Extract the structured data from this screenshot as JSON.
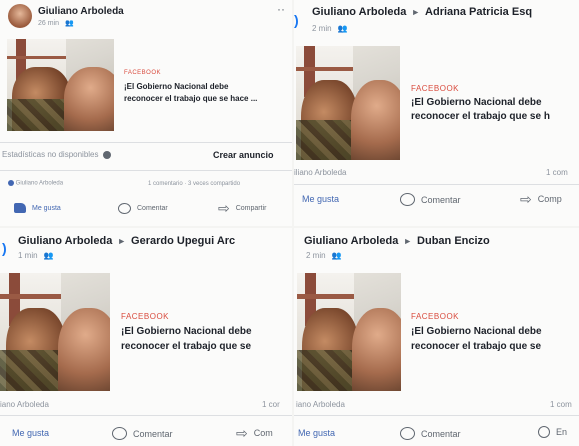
{
  "posts": [
    {
      "author": "Giuliano Arboleda",
      "target": "",
      "time": "26 min",
      "privacy_icon": "friends-icon",
      "source": "FACEBOOK",
      "headline_1": "¡El Gobierno Nacional debe",
      "headline_2": "reconocer el trabajo que se hace ...",
      "stats": "Estadísticas no disponibles",
      "cta": "Crear anuncio",
      "page_name": "Giuliano Arboleda",
      "engagement": "1 comentario · 3 veces compartido",
      "like": "Me gusta",
      "comment": "Comentar",
      "share": "Compartir",
      "more": "··"
    },
    {
      "author": "Giuliano Arboleda",
      "target": "Adriana Patricia Esq",
      "time": "2 min",
      "source": "FACEBOOK",
      "headline_1": "¡El Gobierno Nacional debe",
      "headline_2": "reconocer el trabajo que se h",
      "page_name": "iliano Arboleda",
      "engagement": "1 com",
      "like": "Me gusta",
      "comment": "Comentar",
      "share": "Comp"
    },
    {
      "author": "Giuliano Arboleda",
      "target": "Gerardo Upegui Arc",
      "time": "1 min",
      "source": "FACEBOOK",
      "headline_1": "¡El Gobierno Nacional debe",
      "headline_2": "reconocer el trabajo que se",
      "page_name": "iano Arboleda",
      "engagement": "1 cor",
      "like": "Me gusta",
      "comment": "Comentar",
      "share": "Com"
    },
    {
      "author": "Giuliano Arboleda",
      "target": "Duban Encizo",
      "time": "2 min",
      "source": "FACEBOOK",
      "headline_1": "¡El Gobierno Nacional debe",
      "headline_2": "reconocer el trabajo que se",
      "page_name": "iano Arboleda",
      "engagement": "1 com",
      "like": "Me gusta",
      "comment": "Comentar",
      "share": "En"
    }
  ],
  "colors": {
    "link_blue": "#4267b2",
    "source_red": "#d94b3e",
    "muted": "#8d949e"
  }
}
